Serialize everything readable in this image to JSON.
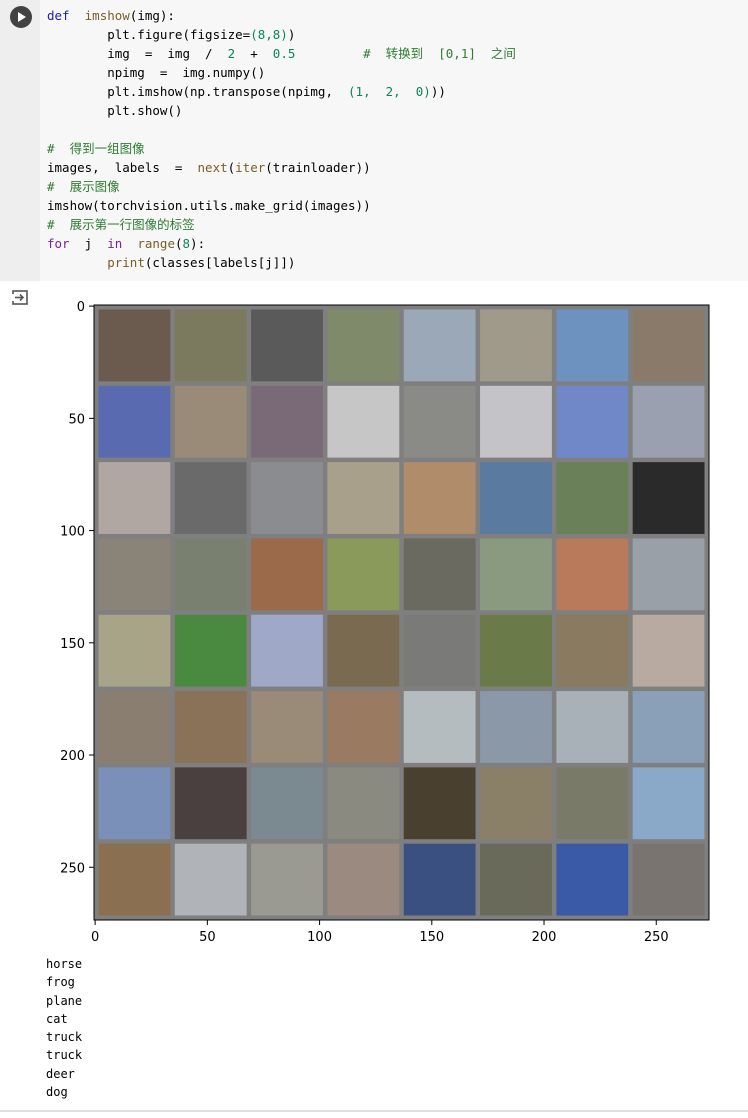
{
  "code_cell": {
    "lines": [
      [
        {
          "t": "def",
          "c": "def"
        },
        {
          "t": "  "
        },
        {
          "t": "imshow",
          "c": "fn"
        },
        {
          "t": "(img):"
        }
      ],
      [
        {
          "t": "        plt.figure(figsize="
        },
        {
          "t": "(8,8)",
          "c": "num"
        },
        {
          "t": ")"
        }
      ],
      [
        {
          "t": "        img  =  img  /  "
        },
        {
          "t": "2",
          "c": "num"
        },
        {
          "t": "  +  "
        },
        {
          "t": "0.5",
          "c": "num"
        },
        {
          "t": "         "
        },
        {
          "t": "#  转换到  [0,1]  之间",
          "c": "cm"
        }
      ],
      [
        {
          "t": "        npimg  =  img.numpy()"
        }
      ],
      [
        {
          "t": "        plt.imshow(np.transpose(npimg,  "
        },
        {
          "t": "(1,  2,  0)",
          "c": "num"
        },
        {
          "t": "))"
        }
      ],
      [
        {
          "t": "        plt.show()"
        }
      ],
      [
        {
          "t": ""
        }
      ],
      [
        {
          "t": "#  得到一组图像",
          "c": "cm"
        }
      ],
      [
        {
          "t": "images,  labels  =  "
        },
        {
          "t": "next",
          "c": "fn"
        },
        {
          "t": "("
        },
        {
          "t": "iter",
          "c": "fn"
        },
        {
          "t": "(trainloader))"
        }
      ],
      [
        {
          "t": "#  展示图像",
          "c": "cm"
        }
      ],
      [
        {
          "t": "imshow(torchvision.utils.make_grid(images))"
        }
      ],
      [
        {
          "t": "#  展示第一行图像的标签",
          "c": "cm"
        }
      ],
      [
        {
          "t": "for",
          "c": "kw"
        },
        {
          "t": "  j  "
        },
        {
          "t": "in",
          "c": "kw"
        },
        {
          "t": "  "
        },
        {
          "t": "range",
          "c": "fn"
        },
        {
          "t": "("
        },
        {
          "t": "8",
          "c": "num"
        },
        {
          "t": "):"
        }
      ],
      [
        {
          "t": "        "
        },
        {
          "t": "print",
          "c": "fn"
        },
        {
          "t": "(classes[labels[j]])"
        }
      ]
    ]
  },
  "output": {
    "icon": "output-redirect-icon",
    "plot": {
      "y_ticks": [
        "0",
        "50",
        "100",
        "150",
        "200",
        "250"
      ],
      "x_ticks": [
        "0",
        "50",
        "100",
        "150",
        "200",
        "250"
      ],
      "y_values": [
        0,
        50,
        100,
        150,
        200,
        250
      ],
      "x_values": [
        0,
        50,
        100,
        150,
        200,
        250
      ],
      "extent": [
        274,
        274
      ],
      "grid_rows": 8,
      "grid_cols": 8,
      "tile_colors": [
        [
          "#6b5a4e",
          "#7b7a5e",
          "#5a5a5a",
          "#7e8a6a",
          "#9aa8b8",
          "#a09a8a",
          "#6e92c0",
          "#8a7a6a"
        ],
        [
          "#5a6ab0",
          "#9a8a78",
          "#7a6a78",
          "#c6c6c6",
          "#8a8a86",
          "#c4c4c8",
          "#7088c8",
          "#9aa0b0"
        ],
        [
          "#b0a6a2",
          "#6a6a6a",
          "#8a8c90",
          "#a8a08a",
          "#b08c6a",
          "#5a7aa0",
          "#6a8058",
          "#2a2a2a"
        ],
        [
          "#8a8478",
          "#7a8070",
          "#9a6a4a",
          "#8a9a5a",
          "#6a6a60",
          "#8a9a80",
          "#b87a5a",
          "#9aa0a8"
        ],
        [
          "#a8a488",
          "#4a8a40",
          "#a0a8c8",
          "#7a6a50",
          "#7a7a78",
          "#6a7a48",
          "#8a7a60",
          "#b8aaa0"
        ],
        [
          "#8a7e70",
          "#8a7258",
          "#9a8a78",
          "#9a7a60",
          "#b4bcc0",
          "#8a98a8",
          "#a8b0b8",
          "#8aa0b8"
        ],
        [
          "#7a90b8",
          "#4a4040",
          "#7a8a90",
          "#8a8a80",
          "#4a4030",
          "#8a8068",
          "#7a7a68",
          "#8aa8c8"
        ],
        [
          "#8a7050",
          "#b0b4b8",
          "#9a9a92",
          "#9a8a80",
          "#3a5080",
          "#6a6a5a",
          "#3a5aa8",
          "#7a7470"
        ]
      ]
    },
    "printed_labels": [
      "horse",
      "frog",
      "plane",
      "cat",
      "truck",
      "truck",
      "deer",
      "dog"
    ]
  }
}
